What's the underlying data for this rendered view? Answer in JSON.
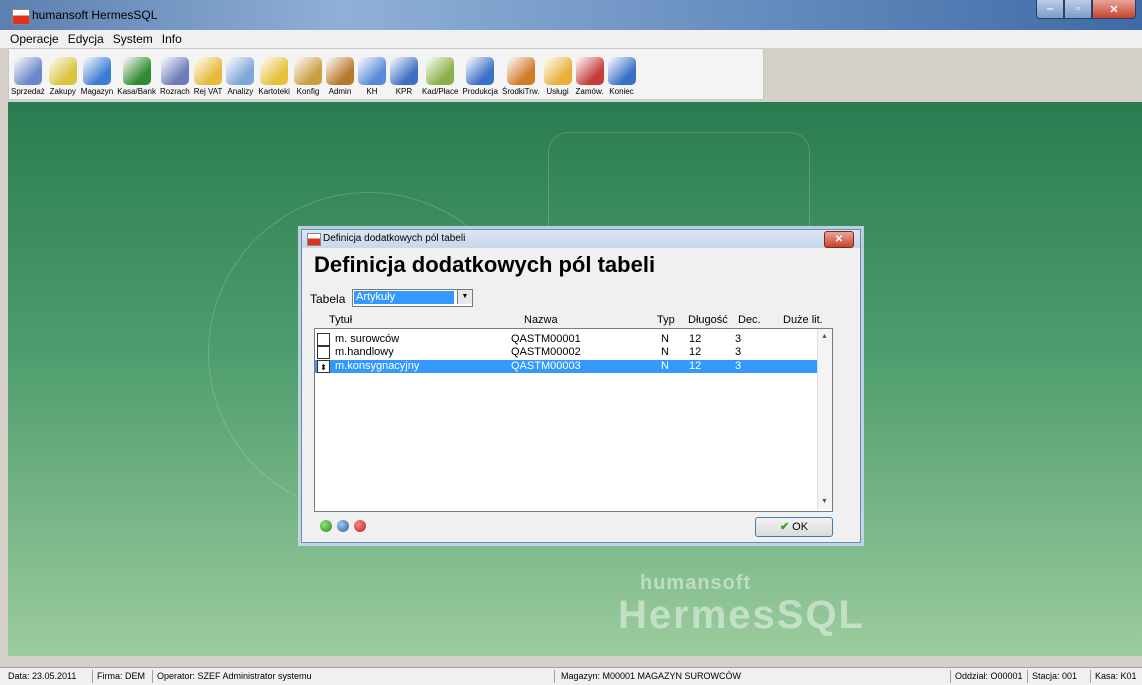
{
  "app": {
    "title": "humansoft HermesSQL"
  },
  "menu": [
    "Operacje",
    "Edycja",
    "System",
    "Info"
  ],
  "toolbar": [
    {
      "label": "Sprzedaż",
      "icon": "sales-icon",
      "color": "#6a87c9"
    },
    {
      "label": "Zakupy",
      "icon": "cart-icon",
      "color": "#d9c43a"
    },
    {
      "label": "Magazyn",
      "icon": "warehouse-icon",
      "color": "#3c7bd6"
    },
    {
      "label": "Kasa/Bank",
      "icon": "money-bags-icon",
      "color": "#2f8a2f"
    },
    {
      "label": "Rozrach",
      "icon": "calculator-icon",
      "color": "#6a7bb8"
    },
    {
      "label": "Rej VAT",
      "icon": "vat-folder-icon",
      "color": "#e6b93a"
    },
    {
      "label": "Analizy",
      "icon": "chart-icon",
      "color": "#7fa6d8"
    },
    {
      "label": "Kartoteki",
      "icon": "folder-icon",
      "color": "#e6c13a"
    },
    {
      "label": "Konfig",
      "icon": "tools-icon",
      "color": "#c8a040"
    },
    {
      "label": "Admin",
      "icon": "admin-stamp-icon",
      "color": "#b8782a"
    },
    {
      "label": "KH",
      "icon": "ma-wn-icon",
      "color": "#5a8ad6"
    },
    {
      "label": "KPR",
      "icon": "book-icon",
      "color": "#3f6fc2"
    },
    {
      "label": "Kad/Płace",
      "icon": "staff-icon",
      "color": "#8ab04a"
    },
    {
      "label": "Produkcja",
      "icon": "production-icon",
      "color": "#3a70c8"
    },
    {
      "label": "ŚrodkiTrw.",
      "icon": "truck-icon",
      "color": "#d07a2a"
    },
    {
      "label": "Usługi",
      "icon": "services-icon",
      "color": "#e6b03a"
    },
    {
      "label": "Zamów.",
      "icon": "orders-icon",
      "color": "#c83a3a"
    },
    {
      "label": "Koniec",
      "icon": "exit-icon",
      "color": "#3a6fc8"
    }
  ],
  "watermark": {
    "brand": "humansoft",
    "product": "HermesSQL"
  },
  "dialog": {
    "window_title": "Definicja dodatkowych pól tabeli",
    "heading": "Definicja dodatkowych pól tabeli",
    "tabela_label": "Tabela",
    "tabela_value": "Artykuły",
    "columns": [
      "Tytuł",
      "Nazwa",
      "Typ",
      "Długość",
      "Dec.",
      "Duże lit."
    ],
    "rows": [
      {
        "tytul": "m. surowców",
        "nazwa": "QASTM00001",
        "typ": "N",
        "dlugosc": "12",
        "dec": "3",
        "selected": false
      },
      {
        "tytul": "m.handlowy",
        "nazwa": "QASTM00002",
        "typ": "N",
        "dlugosc": "12",
        "dec": "3",
        "selected": false
      },
      {
        "tytul": "m.konsygnacyjny",
        "nazwa": "QASTM00003",
        "typ": "N",
        "dlugosc": "12",
        "dec": "3",
        "selected": true
      }
    ],
    "ok_label": "OK"
  },
  "status": {
    "data": "Data: 23.05.2011",
    "firma": "Firma: DEM",
    "operator": "Operator: SZEF Administrator systemu",
    "magazyn": "Magazyn: M00001 MAGAZYN SUROWCÓW",
    "oddzial": "Oddział: O00001",
    "stacja": "Stacja: 001",
    "kasa": "Kasa: K01"
  }
}
